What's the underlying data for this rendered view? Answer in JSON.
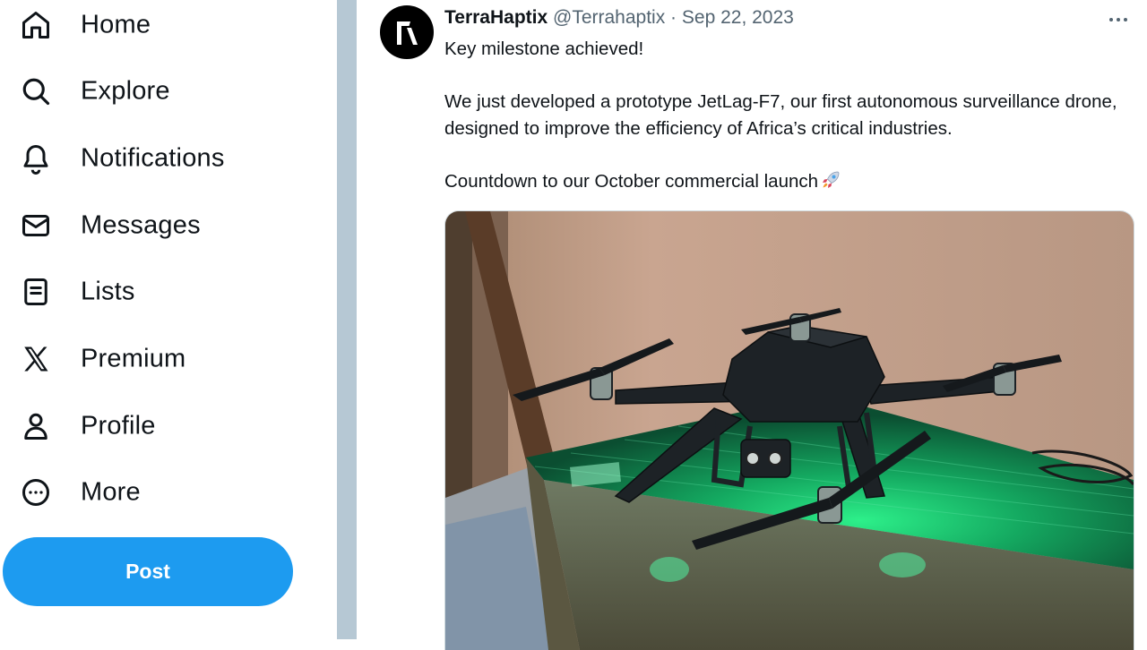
{
  "nav": {
    "items": [
      {
        "label": "Home",
        "icon": "home-icon"
      },
      {
        "label": "Explore",
        "icon": "search-icon"
      },
      {
        "label": "Notifications",
        "icon": "bell-icon"
      },
      {
        "label": "Messages",
        "icon": "envelope-icon"
      },
      {
        "label": "Lists",
        "icon": "list-icon"
      },
      {
        "label": "Premium",
        "icon": "x-logo-icon"
      },
      {
        "label": "Profile",
        "icon": "person-icon"
      },
      {
        "label": "More",
        "icon": "more-circle-icon"
      }
    ],
    "post_label": "Post"
  },
  "tweet": {
    "author_name": "TerraHaptix",
    "handle": "@Terrahaptix",
    "separator": "·",
    "date": "Sep 22, 2023",
    "lines": {
      "line1": "Key milestone achieved!",
      "line2": "We just developed a prototype JetLag-F7, our first autonomous surveillance drone, designed to improve the efficiency of Africa’s critical industries.",
      "line3": "Countdown to our October commercial launch"
    },
    "emoji": "rocket-icon",
    "media": "photo of black quadcopter drone on a table lit with green light"
  },
  "colors": {
    "accent": "#1d9bf0",
    "text": "#0f1419",
    "muted": "#536471",
    "divider": "#b6c8d4"
  }
}
